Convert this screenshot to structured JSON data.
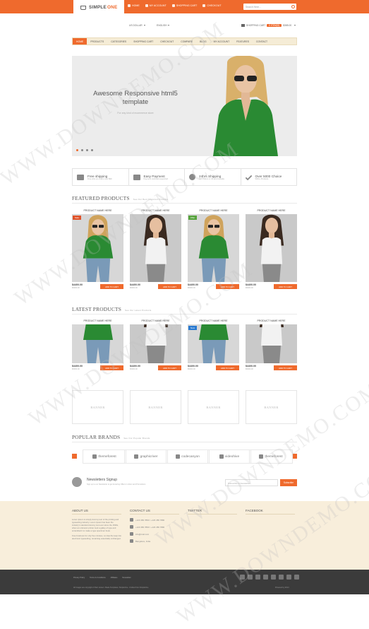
{
  "header": {
    "logo_simple": "SIMPLE",
    "logo_one": "ONE",
    "links": [
      "HOME",
      "MY ACCOUNT",
      "SHOPPING CART",
      "CHECKOUT"
    ],
    "search_placeholder": "Search Here..."
  },
  "subheader": {
    "currency": "US DOLLAR",
    "language": "ENGLISH",
    "cart_label": "SHOPPING CART",
    "cart_count": "0 ITEM(S)",
    "cart_total": "$385.00"
  },
  "nav": [
    "HOME",
    "PRODUCTS",
    "CATEGORIES",
    "SHOPPING CART",
    "CHECKOUT",
    "COMPARE",
    "BLOG",
    "MY ACCOUNT",
    "FEATURES",
    "CONTACT"
  ],
  "hero": {
    "title": "Awesome Responsive html5 template",
    "subtitle": "For any kind of ecommerce store"
  },
  "features": [
    {
      "title": "Free shipping",
      "sub": "Free ship on orders over $99"
    },
    {
      "title": "Easy Payment",
      "sub": "Payment methods supported"
    },
    {
      "title": "24hrs Shipping",
      "sub": "For Orders in US and Canada"
    },
    {
      "title": "Over 5000 Choice",
      "sub": "5000+ Products"
    }
  ],
  "featured": {
    "title": "FEATURED PRODUCTS",
    "subtitle": "See Our Best Featured Products",
    "products": [
      {
        "name": "PRODUCT NAME HERE",
        "price": "$4400.00",
        "old": "$5000.00",
        "tag": "Sale",
        "tag_color": "#e0532a",
        "style": "green"
      },
      {
        "name": "PRODUCT NAME HERE",
        "price": "$4400.00",
        "old": "$5000.00",
        "tag": "",
        "tag_color": "",
        "style": "white"
      },
      {
        "name": "PRODUCT NAME HERE",
        "price": "$4400.00",
        "old": "$5000.00",
        "tag": "Offer",
        "tag_color": "#56a33c",
        "style": "green"
      },
      {
        "name": "PRODUCT NAME HERE",
        "price": "$4400.00",
        "old": "$5000.00",
        "tag": "",
        "tag_color": "",
        "style": "white"
      }
    ]
  },
  "latest": {
    "title": "LATEST PRODUCTS",
    "subtitle": "See Our Latest Products",
    "products": [
      {
        "name": "PRODUCT NAME HERE",
        "price": "$4400.00",
        "old": "$5000.00",
        "tag": "",
        "tag_color": "",
        "style": "green"
      },
      {
        "name": "PRODUCT NAME HERE",
        "price": "$4400.00",
        "old": "$5000.00",
        "tag": "",
        "tag_color": "",
        "style": "white"
      },
      {
        "name": "PRODUCT NAME HERE",
        "price": "$4400.00",
        "old": "$5000.00",
        "tag": "New",
        "tag_color": "#2a7ad1",
        "style": "green"
      },
      {
        "name": "PRODUCT NAME HERE",
        "price": "$4400.00",
        "old": "$5000.00",
        "tag": "",
        "tag_color": "",
        "style": "white"
      }
    ]
  },
  "add_to_cart": "ADD TO CART",
  "banners": [
    "BANNER",
    "BANNER",
    "BANNER",
    "BANNER"
  ],
  "brands": {
    "title": "POPULAR BRANDS",
    "subtitle": "See Our Popular Brands",
    "items": [
      "themeforest",
      "graphicriver",
      "codecanyon",
      "videohive",
      "themeforest"
    ]
  },
  "newsletter": {
    "title": "Newsletters Signup",
    "sub": "Sign up to our Newsletter to get Amazing Offers in inbox and Promotions",
    "placeholder": "Subscribe to Newsletter",
    "button": "Subscribe"
  },
  "footer": {
    "about_title": "ABOUT US",
    "about_text1": "Lorem Ipsum is simply dummy text of the printing and typesetting industry. Lorem Ipsum has been the industry's standard dummy text ever since the 1500s, when an unknown printer took a galley of type and scrambled it to make a type specimen book.",
    "about_text2": "Free business for only five minutes, no idea the leap into electronic typesetting, remaining essentially unchanged.",
    "contact_title": "CONTACT US",
    "contacts": [
      "+123 456 7890 / +123 456 7890",
      "+123 456 7890 / +123 456 7890",
      "info@mail.com",
      "Bangalore, India"
    ],
    "twitter_title": "TWITTER",
    "facebook_title": "FACEBOOK"
  },
  "bottom": {
    "links": [
      "Privacy Policy",
      "Terms & Conditions",
      "Affiliates",
      "Newsletter"
    ],
    "copyright": "All images are copyright of their owners. Made Templates: SimpleOne - Crafted from SimpleOne",
    "powered": "Powered by 2014"
  },
  "watermark": "WWW.DOWNDEMO.COM",
  "colors": {
    "accent": "#ef6a2d",
    "footer_bg": "#f8eedb",
    "bottom_bg": "#3b3b3b"
  }
}
